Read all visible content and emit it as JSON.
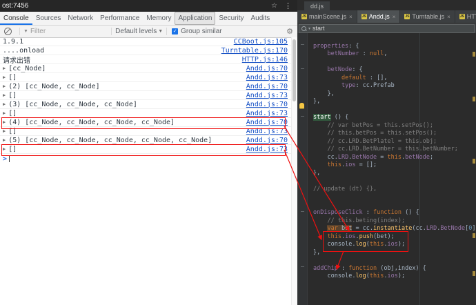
{
  "annotations": {
    "color": "#ee1111"
  },
  "browser": {
    "url_fragment": "ost:7456"
  },
  "devtools": {
    "tabs": [
      "Console",
      "Sources",
      "Network",
      "Performance",
      "Memory",
      "Application",
      "Security",
      "Audits"
    ],
    "selected_tab": "Console",
    "focus_ring_tab": "Application",
    "toolbar": {
      "filter_placeholder": "Filter",
      "levels_label": "Default levels",
      "group_similar_label": "Group similar"
    },
    "prompt_chevron": ">",
    "console_rows": [
      {
        "text": "1.9.1",
        "link": "CCBoot.js:105",
        "arrow": false,
        "boxed": false
      },
      {
        "text": "....onload",
        "link": "Turntable.js:170",
        "arrow": false,
        "boxed": false
      },
      {
        "text": "请求出错",
        "link": "HTTP.js:146",
        "arrow": false,
        "boxed": false
      },
      {
        "text": "[cc_Node]",
        "link": "Andd.js:70",
        "arrow": true,
        "boxed": false
      },
      {
        "text": "[]",
        "link": "Andd.js:73",
        "arrow": true,
        "boxed": false
      },
      {
        "text": "(2) [cc_Node, cc_Node]",
        "link": "Andd.js:70",
        "arrow": true,
        "boxed": false
      },
      {
        "text": "[]",
        "link": "Andd.js:73",
        "arrow": true,
        "boxed": false
      },
      {
        "text": "(3) [cc_Node, cc_Node, cc_Node]",
        "link": "Andd.js:70",
        "arrow": true,
        "boxed": false
      },
      {
        "text": "[]",
        "link": "Andd.js:73",
        "arrow": true,
        "boxed": false
      },
      {
        "text": "(4) [cc_Node, cc_Node, cc_Node, cc_Node]",
        "link": "Andd.js:70",
        "arrow": true,
        "boxed": true
      },
      {
        "text": "[]",
        "link": "Andd.js:73",
        "arrow": true,
        "boxed": false
      },
      {
        "text": "(5) [cc_Node, cc_Node, cc_Node, cc_Node, cc_Node]",
        "link": "Andd.js:70",
        "arrow": true,
        "boxed": false
      },
      {
        "text": "[]",
        "link": "Andd.js:73",
        "arrow": true,
        "boxed": true
      }
    ]
  },
  "ide": {
    "window_tab": "dd.js",
    "tabs": [
      {
        "label": "mainScene.js",
        "selected": false
      },
      {
        "label": "Andd.js",
        "selected": true
      },
      {
        "label": "Turntable.js",
        "selected": false
      },
      {
        "label": "HTTP",
        "selected": false
      }
    ],
    "search": {
      "value": "start"
    },
    "colors": {
      "background": "#2b2b2b",
      "keyword": "#cc7832",
      "field": "#9876aa",
      "comment": "#808080",
      "method": "#ffc66b",
      "plain": "#a9b7c6",
      "search_match_bg": "#32593d"
    },
    "code_lines": [
      [],
      [
        [
          "properties",
          "f"
        ],
        [
          ": {",
          "p"
        ]
      ],
      [
        [
          "    ",
          "p"
        ],
        [
          "betNumber",
          "f"
        ],
        [
          " : ",
          "p"
        ],
        [
          "null",
          "k"
        ],
        [
          ",",
          "p"
        ]
      ],
      [],
      [
        [
          "    ",
          "p"
        ],
        [
          "betNode",
          "f"
        ],
        [
          ": {",
          "p"
        ]
      ],
      [
        [
          "        ",
          "p"
        ],
        [
          "default",
          "k"
        ],
        [
          " : [],",
          "p"
        ]
      ],
      [
        [
          "        ",
          "p"
        ],
        [
          "type",
          "f"
        ],
        [
          ": cc.Prefab",
          "p"
        ]
      ],
      [
        [
          "    },",
          "p"
        ]
      ],
      [
        [
          "},",
          "p"
        ]
      ],
      [],
      [
        [
          "start",
          "hl"
        ],
        [
          " () {",
          "p"
        ]
      ],
      [
        [
          "    ",
          "p"
        ],
        [
          "// var betPos = this.setPos();",
          "c"
        ]
      ],
      [
        [
          "    ",
          "p"
        ],
        [
          "// this.betPos = this.setPos();",
          "c"
        ]
      ],
      [
        [
          "    ",
          "p"
        ],
        [
          "// cc.LRD.BetPlatel = this.obj;",
          "c"
        ]
      ],
      [
        [
          "    ",
          "p"
        ],
        [
          "// cc.LRD.BetNumber = this.betNumber;",
          "c"
        ]
      ],
      [
        [
          "    cc.",
          "p"
        ],
        [
          "LRD",
          "f"
        ],
        [
          ".",
          "p"
        ],
        [
          "BetNode",
          "f"
        ],
        [
          " = ",
          "p"
        ],
        [
          "this",
          "k"
        ],
        [
          ".",
          "p"
        ],
        [
          "betNode",
          "f"
        ],
        [
          ";",
          "p"
        ]
      ],
      [
        [
          "    ",
          "p"
        ],
        [
          "this",
          "k"
        ],
        [
          ".",
          "p"
        ],
        [
          "ios",
          "f"
        ],
        [
          " = [];",
          "p"
        ]
      ],
      [
        [
          "},",
          "p"
        ]
      ],
      [],
      [
        [
          "// update (dt) {},",
          "c"
        ]
      ],
      [],
      [],
      [
        [
          "onDisposeClick",
          "f"
        ],
        [
          " : ",
          "p"
        ],
        [
          "function",
          "k"
        ],
        [
          " () {",
          "p"
        ]
      ],
      [
        [
          "    ",
          "p"
        ],
        [
          "// this.beting(index);",
          "c"
        ]
      ],
      [
        [
          "    ",
          "p"
        ],
        [
          "var",
          "k hv"
        ],
        [
          " bet",
          "p hv"
        ],
        [
          " = cc.",
          "p"
        ],
        [
          "instantiate",
          "m"
        ],
        [
          "(cc.",
          "p"
        ],
        [
          "LRD",
          "f"
        ],
        [
          ".",
          "p"
        ],
        [
          "BetNode",
          "f"
        ],
        [
          "[",
          "p"
        ],
        [
          "0",
          "n"
        ],
        [
          "]);",
          "p"
        ]
      ],
      [
        [
          "    ",
          "p"
        ],
        [
          "this",
          "k"
        ],
        [
          ".",
          "p"
        ],
        [
          "ios",
          "f"
        ],
        [
          ".",
          "p"
        ],
        [
          "push",
          "m"
        ],
        [
          "(bet);",
          "p"
        ]
      ],
      [
        [
          "    ",
          "p"
        ],
        [
          "console",
          "p"
        ],
        [
          ".",
          "p"
        ],
        [
          "log",
          "m"
        ],
        [
          "(",
          "p"
        ],
        [
          "this",
          "k"
        ],
        [
          ".",
          "p"
        ],
        [
          "ios",
          "f"
        ],
        [
          ");",
          "p"
        ]
      ],
      [
        [
          "},",
          "p"
        ]
      ],
      [],
      [
        [
          "addChip",
          "f"
        ],
        [
          " : ",
          "p"
        ],
        [
          "function",
          "k"
        ],
        [
          " (obj,index) {",
          "p"
        ]
      ],
      [
        [
          "    ",
          "p"
        ],
        [
          "console",
          "p"
        ],
        [
          ".",
          "p"
        ],
        [
          "log",
          "m"
        ],
        [
          "(",
          "p"
        ],
        [
          "this",
          "k"
        ],
        [
          ".",
          "p"
        ],
        [
          "ios",
          "f"
        ],
        [
          ");",
          "p"
        ]
      ],
      [],
      []
    ]
  }
}
